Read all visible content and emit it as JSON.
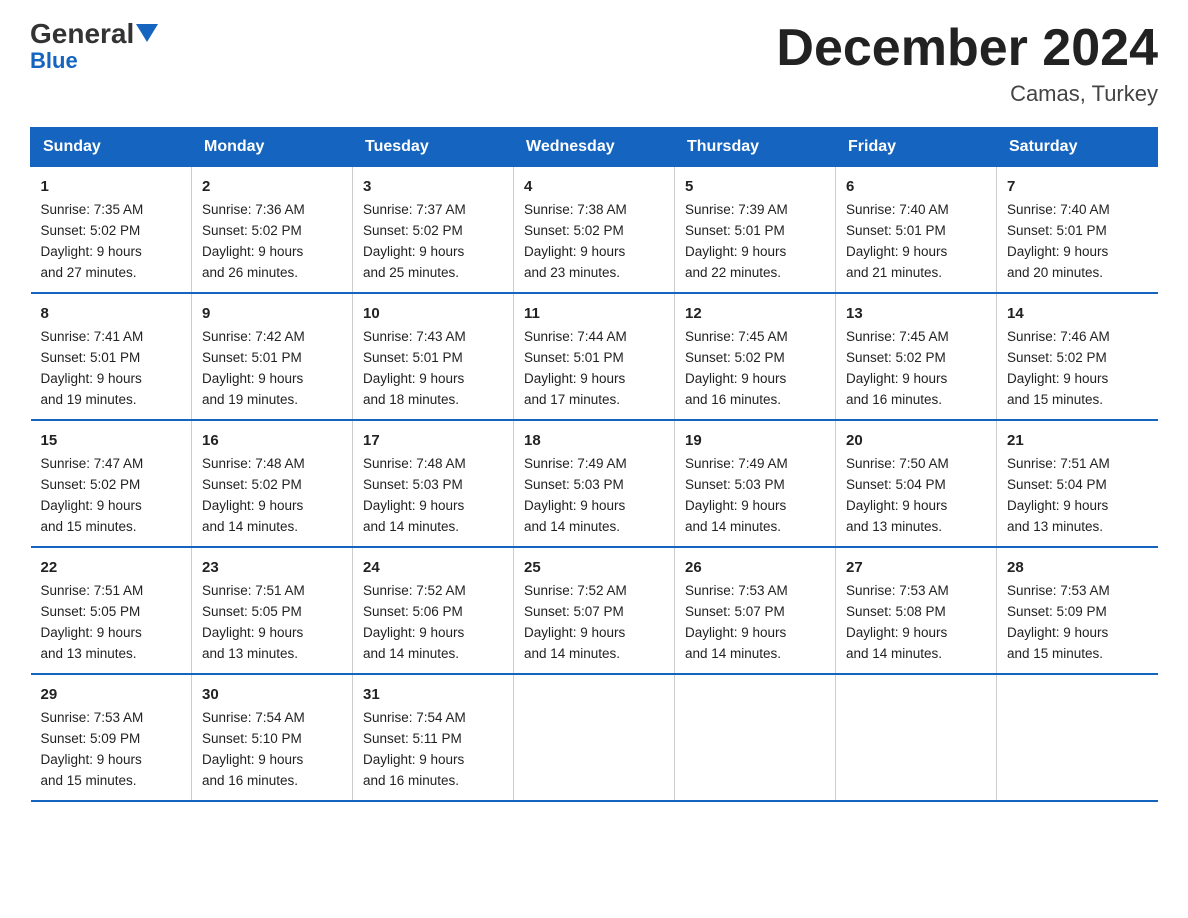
{
  "logo": {
    "general": "General",
    "blue": "Blue"
  },
  "title": "December 2024",
  "location": "Camas, Turkey",
  "days_of_week": [
    "Sunday",
    "Monday",
    "Tuesday",
    "Wednesday",
    "Thursday",
    "Friday",
    "Saturday"
  ],
  "weeks": [
    [
      {
        "day": "1",
        "sunrise": "7:35 AM",
        "sunset": "5:02 PM",
        "daylight": "9 hours and 27 minutes."
      },
      {
        "day": "2",
        "sunrise": "7:36 AM",
        "sunset": "5:02 PM",
        "daylight": "9 hours and 26 minutes."
      },
      {
        "day": "3",
        "sunrise": "7:37 AM",
        "sunset": "5:02 PM",
        "daylight": "9 hours and 25 minutes."
      },
      {
        "day": "4",
        "sunrise": "7:38 AM",
        "sunset": "5:02 PM",
        "daylight": "9 hours and 23 minutes."
      },
      {
        "day": "5",
        "sunrise": "7:39 AM",
        "sunset": "5:01 PM",
        "daylight": "9 hours and 22 minutes."
      },
      {
        "day": "6",
        "sunrise": "7:40 AM",
        "sunset": "5:01 PM",
        "daylight": "9 hours and 21 minutes."
      },
      {
        "day": "7",
        "sunrise": "7:40 AM",
        "sunset": "5:01 PM",
        "daylight": "9 hours and 20 minutes."
      }
    ],
    [
      {
        "day": "8",
        "sunrise": "7:41 AM",
        "sunset": "5:01 PM",
        "daylight": "9 hours and 19 minutes."
      },
      {
        "day": "9",
        "sunrise": "7:42 AM",
        "sunset": "5:01 PM",
        "daylight": "9 hours and 19 minutes."
      },
      {
        "day": "10",
        "sunrise": "7:43 AM",
        "sunset": "5:01 PM",
        "daylight": "9 hours and 18 minutes."
      },
      {
        "day": "11",
        "sunrise": "7:44 AM",
        "sunset": "5:01 PM",
        "daylight": "9 hours and 17 minutes."
      },
      {
        "day": "12",
        "sunrise": "7:45 AM",
        "sunset": "5:02 PM",
        "daylight": "9 hours and 16 minutes."
      },
      {
        "day": "13",
        "sunrise": "7:45 AM",
        "sunset": "5:02 PM",
        "daylight": "9 hours and 16 minutes."
      },
      {
        "day": "14",
        "sunrise": "7:46 AM",
        "sunset": "5:02 PM",
        "daylight": "9 hours and 15 minutes."
      }
    ],
    [
      {
        "day": "15",
        "sunrise": "7:47 AM",
        "sunset": "5:02 PM",
        "daylight": "9 hours and 15 minutes."
      },
      {
        "day": "16",
        "sunrise": "7:48 AM",
        "sunset": "5:02 PM",
        "daylight": "9 hours and 14 minutes."
      },
      {
        "day": "17",
        "sunrise": "7:48 AM",
        "sunset": "5:03 PM",
        "daylight": "9 hours and 14 minutes."
      },
      {
        "day": "18",
        "sunrise": "7:49 AM",
        "sunset": "5:03 PM",
        "daylight": "9 hours and 14 minutes."
      },
      {
        "day": "19",
        "sunrise": "7:49 AM",
        "sunset": "5:03 PM",
        "daylight": "9 hours and 14 minutes."
      },
      {
        "day": "20",
        "sunrise": "7:50 AM",
        "sunset": "5:04 PM",
        "daylight": "9 hours and 13 minutes."
      },
      {
        "day": "21",
        "sunrise": "7:51 AM",
        "sunset": "5:04 PM",
        "daylight": "9 hours and 13 minutes."
      }
    ],
    [
      {
        "day": "22",
        "sunrise": "7:51 AM",
        "sunset": "5:05 PM",
        "daylight": "9 hours and 13 minutes."
      },
      {
        "day": "23",
        "sunrise": "7:51 AM",
        "sunset": "5:05 PM",
        "daylight": "9 hours and 13 minutes."
      },
      {
        "day": "24",
        "sunrise": "7:52 AM",
        "sunset": "5:06 PM",
        "daylight": "9 hours and 14 minutes."
      },
      {
        "day": "25",
        "sunrise": "7:52 AM",
        "sunset": "5:07 PM",
        "daylight": "9 hours and 14 minutes."
      },
      {
        "day": "26",
        "sunrise": "7:53 AM",
        "sunset": "5:07 PM",
        "daylight": "9 hours and 14 minutes."
      },
      {
        "day": "27",
        "sunrise": "7:53 AM",
        "sunset": "5:08 PM",
        "daylight": "9 hours and 14 minutes."
      },
      {
        "day": "28",
        "sunrise": "7:53 AM",
        "sunset": "5:09 PM",
        "daylight": "9 hours and 15 minutes."
      }
    ],
    [
      {
        "day": "29",
        "sunrise": "7:53 AM",
        "sunset": "5:09 PM",
        "daylight": "9 hours and 15 minutes."
      },
      {
        "day": "30",
        "sunrise": "7:54 AM",
        "sunset": "5:10 PM",
        "daylight": "9 hours and 16 minutes."
      },
      {
        "day": "31",
        "sunrise": "7:54 AM",
        "sunset": "5:11 PM",
        "daylight": "9 hours and 16 minutes."
      },
      null,
      null,
      null,
      null
    ]
  ]
}
